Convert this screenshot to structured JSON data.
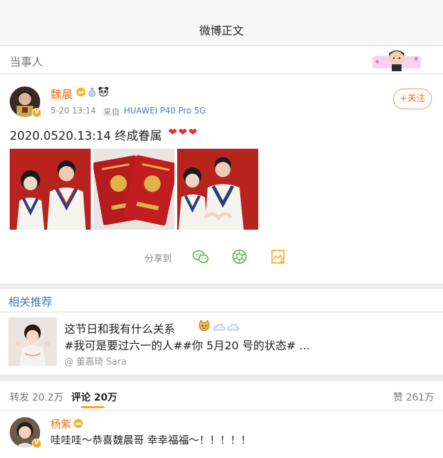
{
  "nav": {
    "title": "微博正文"
  },
  "tag_bar": {
    "label": "当事人"
  },
  "post": {
    "author": "魏晨",
    "verified_mark": "V",
    "time": "5-20 13:14",
    "source_prefix": "来自",
    "source": "HUAWEI P40 Pro 5G",
    "follow_label": "+关注",
    "text": "2020.0520.13:14 终成眷属",
    "emoji_hearts": "❤❤❤",
    "share_label": "分享到",
    "icons": [
      "wechat-icon",
      "moments-icon",
      "save-image-icon"
    ]
  },
  "recommend": {
    "title": "相关推荐",
    "line1": "这节日和我有什么关系",
    "line2": "#我可是要过六一的人##你 5月20 号的状态# ...",
    "author": "@ 董嘉琦 Sara"
  },
  "tabs": {
    "repost": "转发 20.2万",
    "comments": "评论 20万",
    "likes": "赞 261万"
  },
  "comment": {
    "author": "杨紫",
    "text": "哇哇哇～恭喜魏晨哥 幸幸福福～！！！！！"
  },
  "colors": {
    "accent": "#f36f0f",
    "link": "#4a7bb7",
    "tab_underline": "#f5a623",
    "heart": "#e62b2b"
  }
}
